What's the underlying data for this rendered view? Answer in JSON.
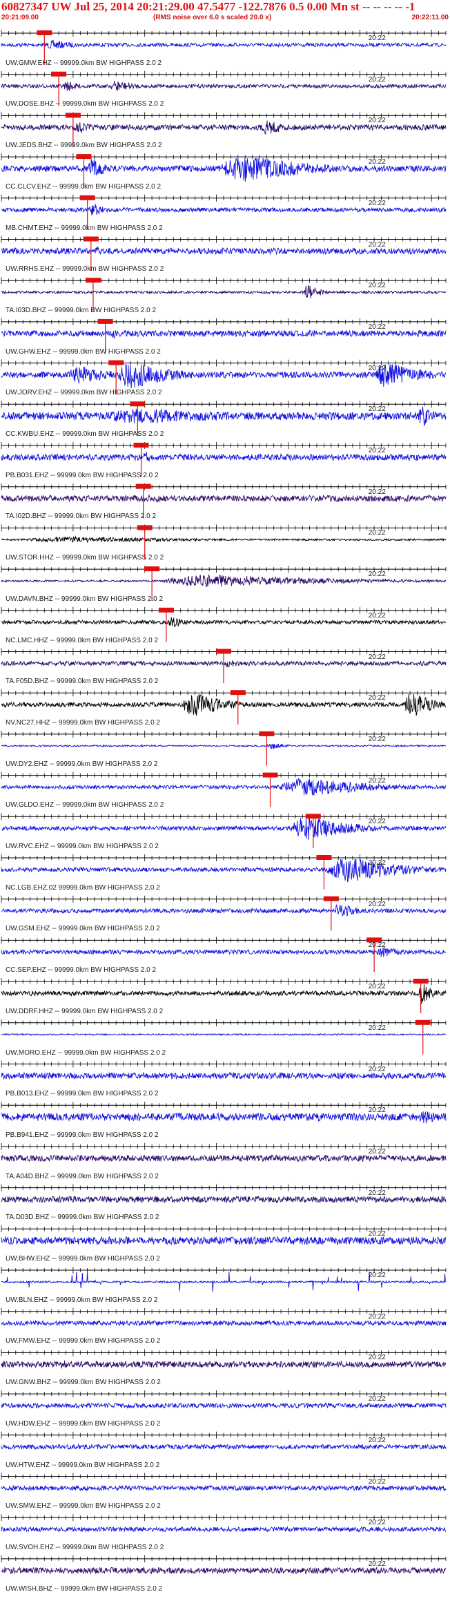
{
  "header": {
    "title": "60827347 UW Jul 25, 2014 20:21:29.00   47.5477 -122.7876  0.5 0.00 Mn st -- -- -- -- -1",
    "start_time": "20:21:09.00",
    "note": "(RMS noise over 6.0 s scaled 20.0 x)",
    "end_time": "20:22:11.00"
  },
  "colors": {
    "blue": "#1010e0",
    "purple": "#2a0a6a",
    "black": "#000000",
    "pick": "#e01010",
    "axis": "#000000"
  },
  "chart_data": {
    "type": "line",
    "title": "60827347 UW Jul 25, 2014 20:21:29.00   47.5477 -122.7876  0.5 0.00 Mn st -- -- -- -- -1",
    "x_start": "20:21:09.00",
    "x_end": "20:22:11.00",
    "tick_label": "20:22",
    "tick_label_time_s": 51,
    "duration_s": 62,
    "traces": [
      {
        "label": "UW.GMW.EHZ -- 99999.0km BW  HIGHPASS  2.0  2",
        "color": "blue",
        "pick_s": 6.0,
        "bursts": [
          [
            5.8,
            8,
            0.3
          ]
        ],
        "noise": 0.12
      },
      {
        "label": "UW.DOSE.BHZ -- 99999.0km BW  HIGHPASS  2.0  2",
        "color": "purple",
        "pick_s": 8.0,
        "bursts": [
          [
            8.5,
            4,
            0.35
          ],
          [
            15,
            6,
            0.4
          ]
        ],
        "noise": 0.12
      },
      {
        "label": "UW.JEDS.BHZ -- 99999.0km BW  HIGHPASS  2.0  2",
        "color": "purple",
        "pick_s": 10.0,
        "bursts": [
          [
            10,
            5,
            0.4
          ],
          [
            36,
            6,
            0.5
          ]
        ],
        "noise": 0.18
      },
      {
        "label": "CC.CLCV.EHZ -- 99999.0km BW  HIGHPASS  2.0  2",
        "color": "blue",
        "pick_s": 11.5,
        "bursts": [
          [
            12,
            4,
            0.7
          ],
          [
            30,
            20,
            0.9
          ]
        ],
        "noise": 0.2
      },
      {
        "label": "MB.CHMT.EHZ -- 99999.0km BW  HIGHPASS  2.0  2",
        "color": "blue",
        "pick_s": 12.0,
        "bursts": [
          [
            12.2,
            3,
            0.5
          ]
        ],
        "noise": 0.14
      },
      {
        "label": "UW.RRHS.EHZ -- 99999.0km BW  HIGHPASS  2.0  2",
        "color": "blue",
        "pick_s": 12.5,
        "bursts": [
          [
            12.5,
            4,
            0.3
          ]
        ],
        "noise": 0.2
      },
      {
        "label": "TA.I03D.BHZ -- 99999.0km BW  HIGHPASS  2.0  2",
        "color": "purple",
        "pick_s": 12.8,
        "bursts": [
          [
            42,
            4,
            0.5
          ]
        ],
        "noise": 0.08
      },
      {
        "label": "UW.GHW.EHZ -- 99999.0km BW  HIGHPASS  2.0  2",
        "color": "blue",
        "pick_s": 14.5,
        "bursts": [
          [
            15,
            3,
            0.4
          ]
        ],
        "noise": 0.2
      },
      {
        "label": "UW.JORV.EHZ -- 99999.0km BW  HIGHPASS  2.0  2",
        "color": "blue",
        "pick_s": 16.0,
        "bursts": [
          [
            9,
            10,
            0.6
          ],
          [
            16,
            12,
            0.95
          ],
          [
            52,
            10,
            0.95
          ]
        ],
        "noise": 0.2
      },
      {
        "label": "CC.KWBU.EHZ -- 99999.0km BW  HIGHPASS  2.0  2",
        "color": "blue",
        "pick_s": 19.0,
        "bursts": [
          [
            12,
            40,
            0.5
          ],
          [
            58,
            4,
            0.7
          ]
        ],
        "noise": 0.25
      },
      {
        "label": "PB.B031.EHZ -- 99999.0km BW  HIGHPASS  2.0  2",
        "color": "blue",
        "pick_s": 19.5,
        "bursts": [
          [
            19.5,
            4,
            0.35
          ]
        ],
        "noise": 0.2
      },
      {
        "label": "TA.I02D.BHZ -- 99999.0km BW  HIGHPASS  2.0  2",
        "color": "purple",
        "pick_s": 19.8,
        "bursts": [
          [
            20,
            6,
            0.3
          ]
        ],
        "noise": 0.2
      },
      {
        "label": "UW.STOR.HHZ -- 99999.0km BW  HIGHPASS  2.0  2",
        "color": "black",
        "pick_s": 20.0,
        "bursts": [
          [
            2,
            40,
            0.2
          ]
        ],
        "noise": 0.06
      },
      {
        "label": "UW.DAVN.BHZ -- 99999.0km BW  HIGHPASS  2.0  2",
        "color": "purple",
        "pick_s": 21.0,
        "bursts": [
          [
            21.5,
            40,
            0.4
          ]
        ],
        "noise": 0.06
      },
      {
        "label": "NC.LMC.HHZ -- 99999.0km BW  HIGHPASS  2.0  2",
        "color": "black",
        "pick_s": 23.0,
        "bursts": [
          [
            23,
            5,
            0.35
          ]
        ],
        "noise": 0.12
      },
      {
        "label": "TA.F05D.BHZ -- 99999.0km BW  HIGHPASS  2.0  2",
        "color": "purple",
        "pick_s": 31.0,
        "bursts": [
          [
            31,
            4,
            0.3
          ]
        ],
        "noise": 0.14
      },
      {
        "label": "NV.NC27.HHZ -- 99999.0km BW  HIGHPASS  2.0  2",
        "color": "black",
        "pick_s": 33.0,
        "bursts": [
          [
            25,
            10,
            0.8
          ],
          [
            56,
            6,
            0.95
          ]
        ],
        "noise": 0.15
      },
      {
        "label": "UW.DY2.EHZ -- 99999.0km BW  HIGHPASS  2.0  2",
        "color": "blue",
        "pick_s": 37.0,
        "bursts": [
          [
            37,
            4,
            0.25
          ]
        ],
        "noise": 0.05
      },
      {
        "label": "UW.GLDO.EHZ -- 99999.0km BW  HIGHPASS  2.0  2",
        "color": "blue",
        "pick_s": 37.5,
        "bursts": [
          [
            38,
            22,
            0.6
          ]
        ],
        "noise": 0.12
      },
      {
        "label": "UW.RVC.EHZ -- 99999.0km BW  HIGHPASS  2.0  2",
        "color": "blue",
        "pick_s": 43.5,
        "bursts": [
          [
            40,
            14,
            0.8
          ]
        ],
        "noise": 0.14
      },
      {
        "label": "NC.LGB.EHZ.02 99999.0km BW  HIGHPASS  2.0  2",
        "color": "blue",
        "pick_s": 45.0,
        "bursts": [
          [
            45,
            17,
            0.85
          ]
        ],
        "noise": 0.14
      },
      {
        "label": "UW.GSM.EHZ -- 99999.0km BW  HIGHPASS  2.0  2",
        "color": "blue",
        "pick_s": 46.0,
        "bursts": [
          [
            46,
            6,
            0.5
          ]
        ],
        "noise": 0.14
      },
      {
        "label": "CC.SEP.EHZ -- 99999.0km BW  HIGHPASS  2.0  2",
        "color": "blue",
        "pick_s": 52.0,
        "bursts": [
          [
            52,
            6,
            0.35
          ]
        ],
        "noise": 0.14
      },
      {
        "label": "UW.DDRF.HHZ -- 99999.0km BW  HIGHPASS  2.0  2",
        "color": "black",
        "pick_s": 58.5,
        "bursts": [
          [
            58,
            4,
            0.7
          ]
        ],
        "noise": 0.15
      },
      {
        "label": "UW.MORO.EHZ -- 99999.0km BW  HIGHPASS  2.0  2",
        "color": "blue",
        "pick_s": 58.8,
        "bursts": [],
        "noise": 0.05
      },
      {
        "label": "PB.B013.EHZ -- 99999.0km BW  HIGHPASS  2.0  2",
        "color": "blue",
        "pick_s": null,
        "bursts": [],
        "noise": 0.2
      },
      {
        "label": "PB.B941.EHZ -- 99999.0km BW  HIGHPASS  2.0  2",
        "color": "blue",
        "pick_s": null,
        "bursts": [
          [
            58,
            5,
            0.5
          ]
        ],
        "noise": 0.25
      },
      {
        "label": "TA.A04D.BHZ -- 99999.0km BW  HIGHPASS  2.0  2",
        "color": "purple",
        "pick_s": null,
        "bursts": [],
        "noise": 0.2
      },
      {
        "label": "TA.D03D.BHZ -- 99999.0km BW  HIGHPASS  2.0  2",
        "color": "purple",
        "pick_s": null,
        "bursts": [],
        "noise": 0.2
      },
      {
        "label": "UW.BHW.EHZ -- 99999.0km BW  HIGHPASS  2.0  2",
        "color": "blue",
        "pick_s": null,
        "bursts": [],
        "noise": 0.25
      },
      {
        "label": "UW.BLN.EHZ -- 99999.0km BW  HIGHPASS  2.0  2",
        "color": "blue",
        "pick_s": null,
        "bursts": [],
        "noise": 0.06,
        "spiky": true
      },
      {
        "label": "UW.FMW.EHZ -- 99999.0km BW  HIGHPASS  2.0  2",
        "color": "blue",
        "pick_s": null,
        "bursts": [],
        "noise": 0.15
      },
      {
        "label": "UW.GNW.BHZ -- 99999.0km BW  HIGHPASS  2.0  2",
        "color": "purple",
        "pick_s": null,
        "bursts": [
          [
            8,
            3,
            0.3
          ]
        ],
        "noise": 0.2
      },
      {
        "label": "UW.HDW.EHZ -- 99999.0km BW  HIGHPASS  2.0  2",
        "color": "blue",
        "pick_s": null,
        "bursts": [],
        "noise": 0.15
      },
      {
        "label": "UW.HTW.EHZ -- 99999.0km BW  HIGHPASS  2.0  2",
        "color": "blue",
        "pick_s": null,
        "bursts": [],
        "noise": 0.15
      },
      {
        "label": "UW.SMW.EHZ -- 99999.0km BW  HIGHPASS  2.0  2",
        "color": "blue",
        "pick_s": null,
        "bursts": [],
        "noise": 0.15
      },
      {
        "label": "UW.SVOH.EHZ -- 99999.0km BW  HIGHPASS  2.0  2",
        "color": "blue",
        "pick_s": null,
        "bursts": [],
        "noise": 0.15
      },
      {
        "label": "UW.WISH.BHZ -- 99999.0km BW  HIGHPASS  2.0  2",
        "color": "purple",
        "pick_s": null,
        "bursts": [],
        "noise": 0.2
      }
    ]
  }
}
